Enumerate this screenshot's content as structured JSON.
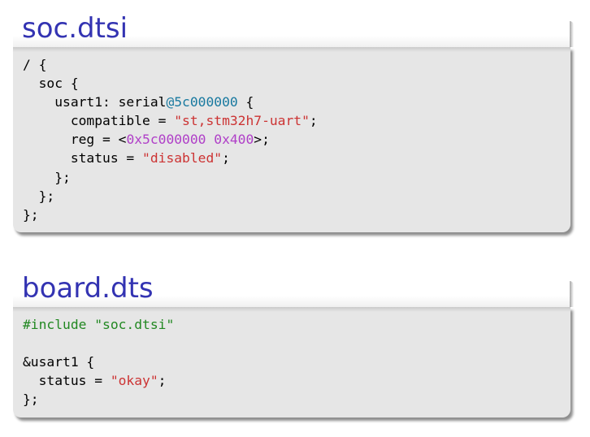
{
  "blocks": [
    {
      "title": "soc.dtsi",
      "lines": [
        [
          {
            "t": "/ {"
          }
        ],
        [
          {
            "t": "  soc {"
          }
        ],
        [
          {
            "t": "    usart1: serial"
          },
          {
            "t": "@5c000000",
            "c": "addr"
          },
          {
            "t": " {"
          }
        ],
        [
          {
            "t": "      compatible = "
          },
          {
            "t": "\"st,stm32h7-uart\"",
            "c": "str"
          },
          {
            "t": ";"
          }
        ],
        [
          {
            "t": "      reg = <"
          },
          {
            "t": "0x5c000000 0x400",
            "c": "num"
          },
          {
            "t": ">;"
          }
        ],
        [
          {
            "t": "      status = "
          },
          {
            "t": "\"disabled\"",
            "c": "str"
          },
          {
            "t": ";"
          }
        ],
        [
          {
            "t": "    };"
          }
        ],
        [
          {
            "t": "  };"
          }
        ],
        [
          {
            "t": "};"
          }
        ]
      ]
    },
    {
      "title": "board.dts",
      "lines": [
        [
          {
            "t": "#include \"soc.dtsi\"",
            "c": "pre"
          }
        ],
        [
          {
            "t": ""
          }
        ],
        [
          {
            "t": "&usart1 {"
          }
        ],
        [
          {
            "t": "  status = "
          },
          {
            "t": "\"okay\"",
            "c": "str"
          },
          {
            "t": ";"
          }
        ],
        [
          {
            "t": "};"
          }
        ]
      ]
    }
  ],
  "colors": {
    "title": "#3333b2",
    "block_bg": "#e6e6e6",
    "string": "#cc3333",
    "number": "#b040c8",
    "address": "#1a7aa0",
    "preprocessor": "#228822"
  }
}
